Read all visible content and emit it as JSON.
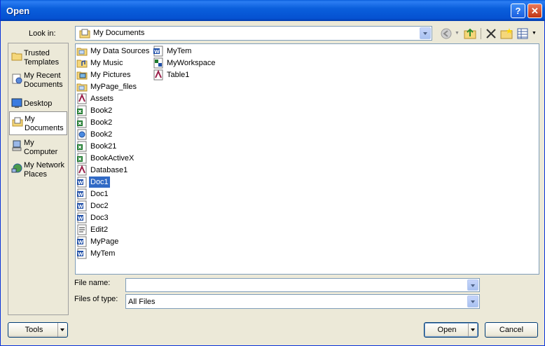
{
  "window": {
    "title": "Open",
    "help_label": "?",
    "close_label": "✕"
  },
  "lookin": {
    "label": "Look in:",
    "value": "My Documents"
  },
  "places": [
    {
      "label": "Trusted Templates",
      "icon": "folder-icon"
    },
    {
      "label": "My Recent Documents",
      "icon": "recent-documents-icon"
    },
    {
      "label": "Desktop",
      "icon": "desktop-icon"
    },
    {
      "label": "My Documents",
      "icon": "my-documents-icon",
      "active": true
    },
    {
      "label": "My Computer",
      "icon": "computer-icon"
    },
    {
      "label": "My Network Places",
      "icon": "network-icon"
    }
  ],
  "files_col1": [
    {
      "name": "My Data Sources",
      "type": "folder"
    },
    {
      "name": "My Music",
      "type": "folder-music"
    },
    {
      "name": "My Pictures",
      "type": "folder-pictures"
    },
    {
      "name": "MyPage_files",
      "type": "folder"
    },
    {
      "name": "Assets",
      "type": "access"
    },
    {
      "name": "Book2",
      "type": "excel"
    },
    {
      "name": "Book2",
      "type": "excel"
    },
    {
      "name": "Book2",
      "type": "web-excel"
    },
    {
      "name": "Book21",
      "type": "excel"
    },
    {
      "name": "BookActiveX",
      "type": "excel"
    },
    {
      "name": "Database1",
      "type": "access"
    },
    {
      "name": "Doc1",
      "type": "word",
      "selected": true
    },
    {
      "name": "Doc1",
      "type": "word"
    },
    {
      "name": "Doc2",
      "type": "word"
    },
    {
      "name": "Doc3",
      "type": "word"
    },
    {
      "name": "Edit2",
      "type": "form"
    },
    {
      "name": "MyPage",
      "type": "word"
    },
    {
      "name": "MyTem",
      "type": "word"
    }
  ],
  "files_col2": [
    {
      "name": "MyTem",
      "type": "word"
    },
    {
      "name": "MyWorkspace",
      "type": "workspace"
    },
    {
      "name": "Table1",
      "type": "access"
    }
  ],
  "filename": {
    "label": "File name:",
    "value": ""
  },
  "filetype": {
    "label": "Files of type:",
    "value": "All Files"
  },
  "buttons": {
    "tools": "Tools",
    "open": "Open",
    "cancel": "Cancel"
  },
  "toolbar": {
    "back": "back-icon",
    "up": "up-folder-icon",
    "delete": "delete-icon",
    "new_folder": "new-folder-icon",
    "views": "views-icon"
  }
}
